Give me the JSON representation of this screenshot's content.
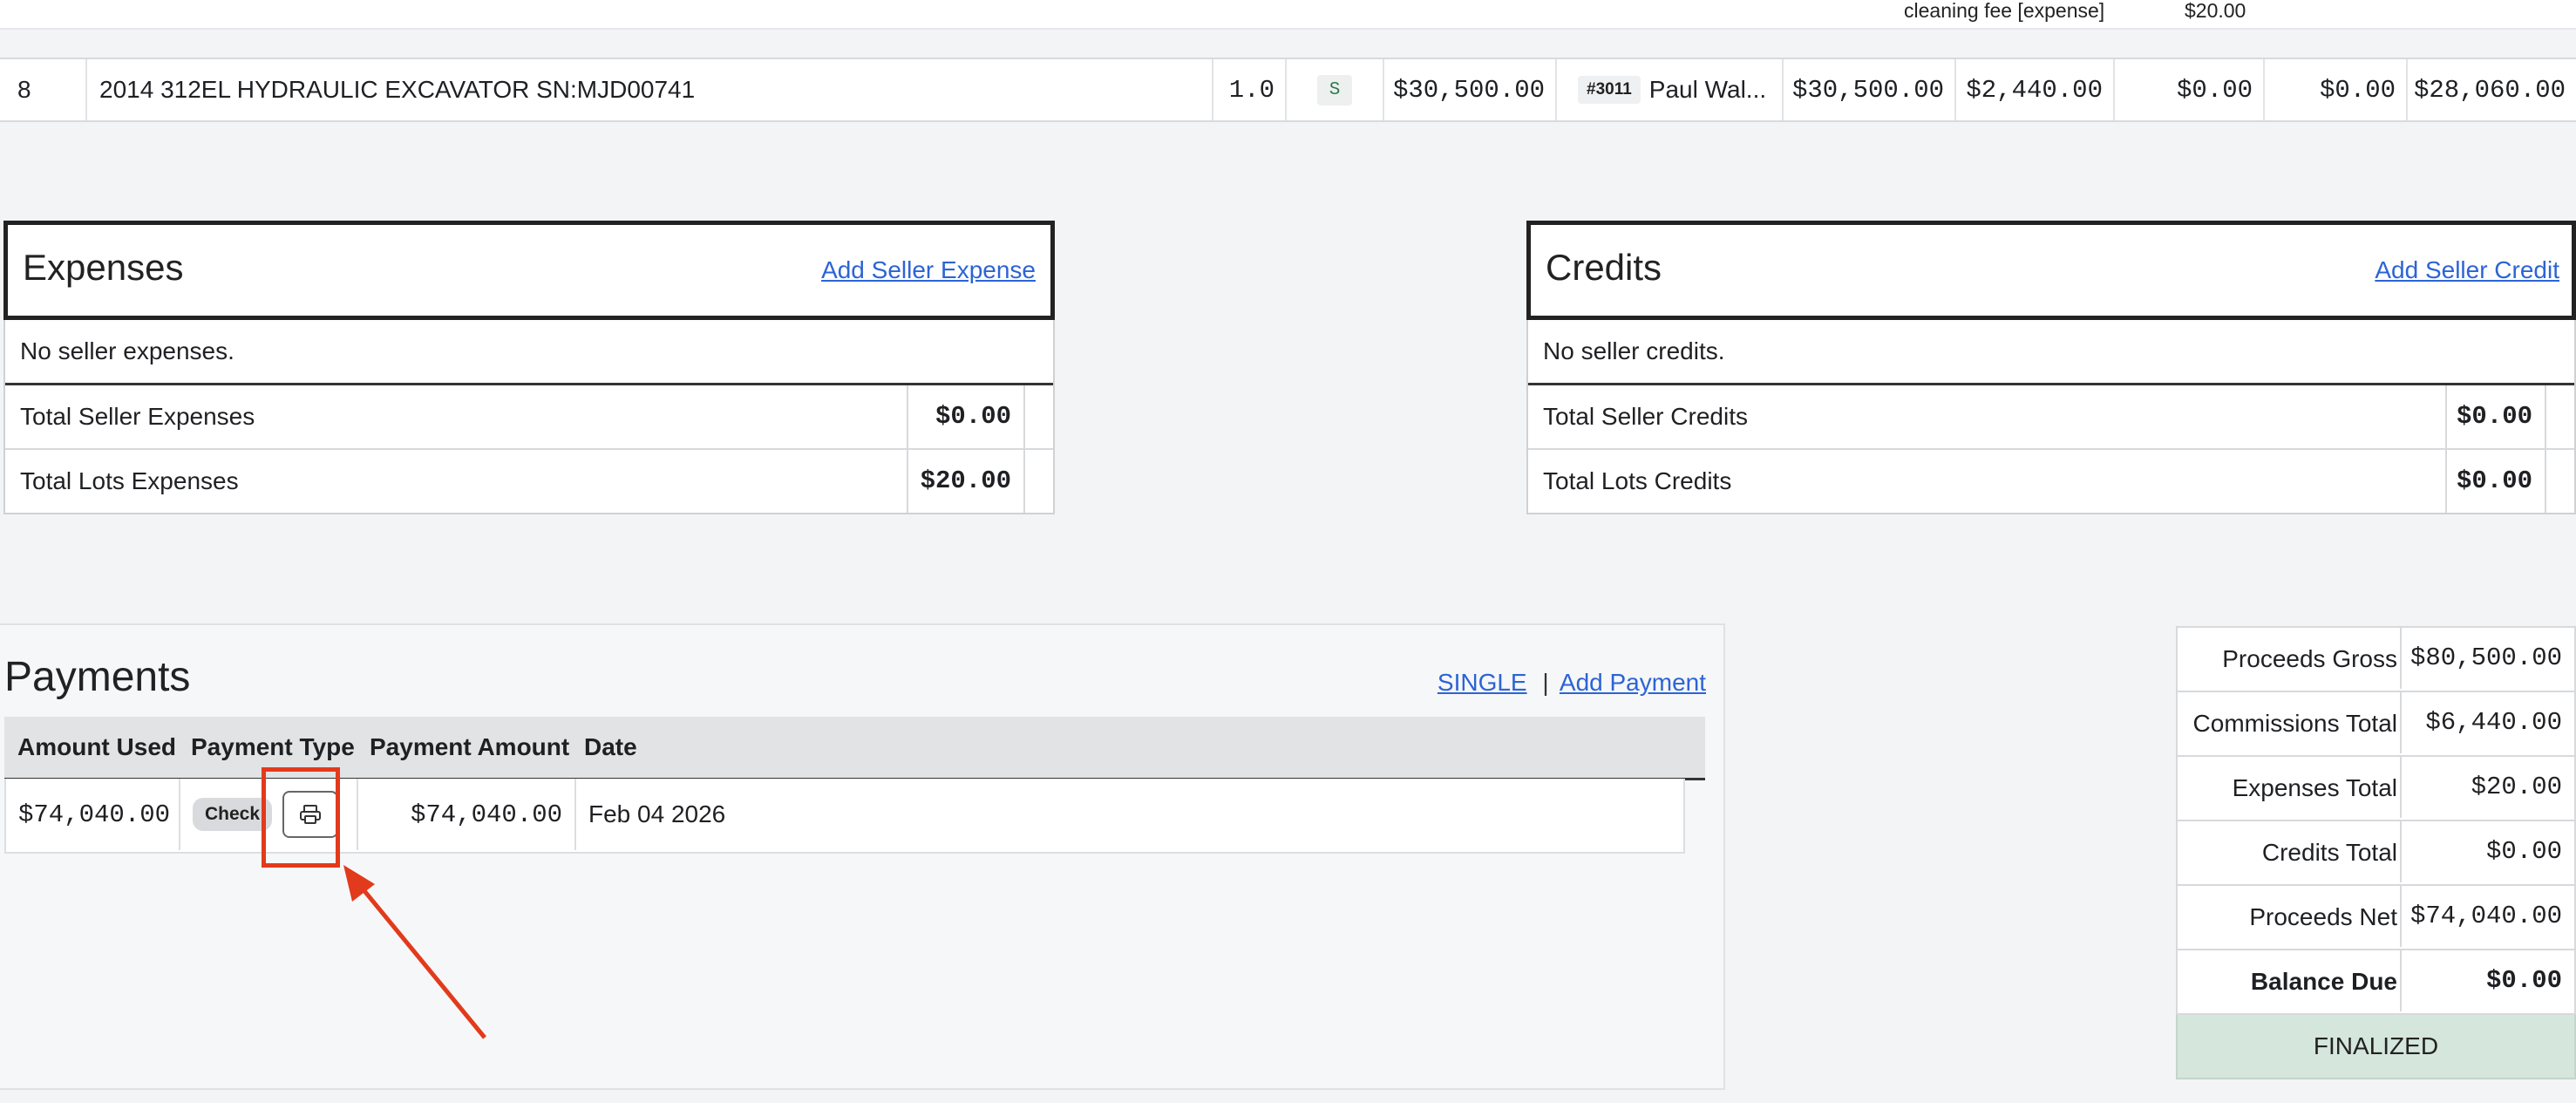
{
  "lot_table": {
    "partial_row": {
      "label": "cleaning fee [expense]",
      "amount": "$20.00"
    },
    "row": {
      "lot_number": "8",
      "description": "2014 312EL HYDRAULIC EXCAVATOR SN:MJD00741",
      "quantity": "1.0",
      "status_badge": "S",
      "hammer_price": "$30,500.00",
      "buyer_number": "#3011",
      "buyer_name": "Paul Wal...",
      "gross": "$30,500.00",
      "commission": "$2,440.00",
      "expenses": "$0.00",
      "credits": "$0.00",
      "net": "$28,060.00"
    }
  },
  "expenses": {
    "title": "Expenses",
    "add_link": "Add Seller Expense",
    "empty_text": "No seller expenses.",
    "rows": [
      {
        "label": "Total Seller Expenses",
        "value": "$0.00"
      },
      {
        "label": "Total Lots Expenses",
        "value": "$20.00"
      }
    ]
  },
  "credits": {
    "title": "Credits",
    "add_link": "Add Seller Credit",
    "empty_text": "No seller credits.",
    "rows": [
      {
        "label": "Total Seller Credits",
        "value": "$0.00"
      },
      {
        "label": "Total Lots Credits",
        "value": "$0.00"
      }
    ]
  },
  "payments": {
    "title": "Payments",
    "single_link": "SINGLE",
    "separator": "|",
    "add_link": "Add Payment",
    "columns": [
      "Amount Used",
      "Payment Type",
      "Payment Amount",
      "Date"
    ],
    "rows": [
      {
        "amount_used": "$74,040.00",
        "payment_type": "Check",
        "payment_amount": "$74,040.00",
        "date": "Feb 04 2026",
        "action_icon": "printer-icon"
      }
    ]
  },
  "summary": {
    "rows": [
      {
        "label": "Proceeds Gross",
        "value": "$80,500.00"
      },
      {
        "label": "Commissions Total",
        "value": "$6,440.00"
      },
      {
        "label": "Expenses Total",
        "value": "$20.00"
      },
      {
        "label": "Credits Total",
        "value": "$0.00"
      },
      {
        "label": "Proceeds Net",
        "value": "$74,040.00"
      },
      {
        "label": "Balance Due",
        "value": "$0.00"
      }
    ],
    "status": "FINALIZED"
  },
  "colors": {
    "link": "#2c64d4",
    "annotation": "#e23a1c",
    "finalized_bg": "#d5e6dc",
    "badge_s": "#2c7a47"
  }
}
